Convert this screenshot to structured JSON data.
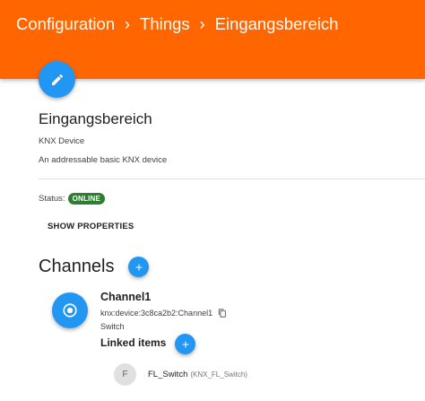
{
  "breadcrumb": {
    "items": [
      "Configuration",
      "Things",
      "Eingangsbereich"
    ],
    "separator": "›"
  },
  "colors": {
    "header": "#ff6600",
    "fab": "#2196f3",
    "status_online": "#2e7d32"
  },
  "thing": {
    "title": "Eingangsbereich",
    "type": "KNX Device",
    "description": "An addressable basic KNX device",
    "status_label": "Status:",
    "status_value": "ONLINE",
    "show_properties_label": "SHOW PROPERTIES",
    "edit_icon": "pencil-icon"
  },
  "channels": {
    "title": "Channels",
    "add_icon": "plus-icon",
    "items": [
      {
        "name": "Channel1",
        "uid": "knx:device:3c8ca2b2:Channel1",
        "type": "Switch",
        "icon": "radio-target-icon",
        "copy_icon": "copy-icon",
        "linked_items_title": "Linked items",
        "linked_items": [
          {
            "avatar": "F",
            "name": "FL_Switch",
            "label": "(KNX_FL_Switch)"
          }
        ]
      }
    ]
  }
}
